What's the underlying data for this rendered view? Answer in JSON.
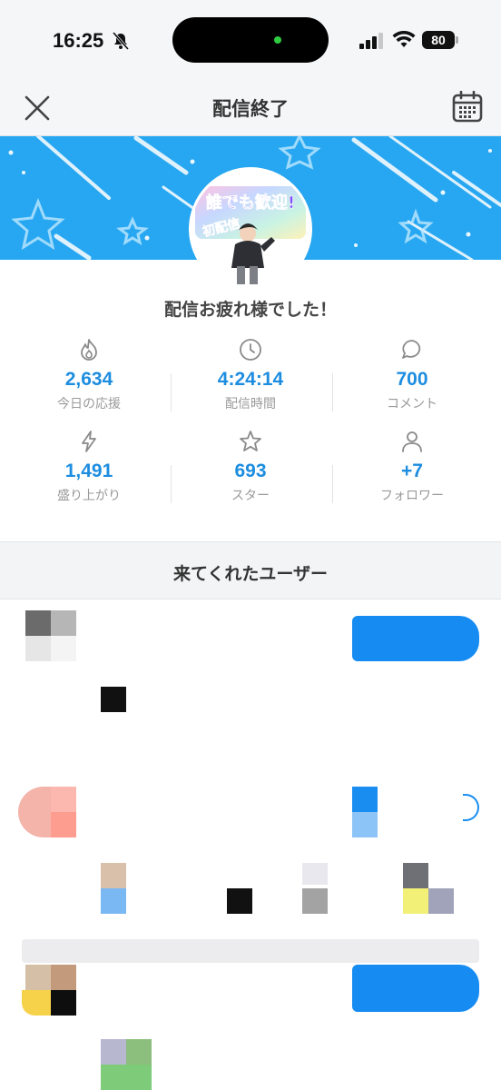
{
  "status_bar": {
    "time": "16:25",
    "battery": "80"
  },
  "nav": {
    "title": "配信終了"
  },
  "banner": {
    "avatar_text": [
      "誰でも歓迎!",
      "初配信"
    ],
    "colors": {
      "banner": "#27a7f1",
      "accent": "#1d8de0"
    }
  },
  "summary": {
    "message": "配信お疲れ様でした！",
    "stats": [
      {
        "icon": "flame-icon",
        "value": "2,634",
        "label": "今日の応援"
      },
      {
        "icon": "clock-icon",
        "value": "4:24:14",
        "label": "配信時間"
      },
      {
        "icon": "comment-icon",
        "value": "700",
        "label": "コメント"
      },
      {
        "icon": "lightning-icon",
        "value": "1,491",
        "label": "盛り上がり"
      },
      {
        "icon": "star-icon",
        "value": "693",
        "label": "スター"
      },
      {
        "icon": "person-icon",
        "value": "+7",
        "label": "フォロワー"
      }
    ]
  },
  "visitors": {
    "title": "来てくれたユーザー"
  }
}
